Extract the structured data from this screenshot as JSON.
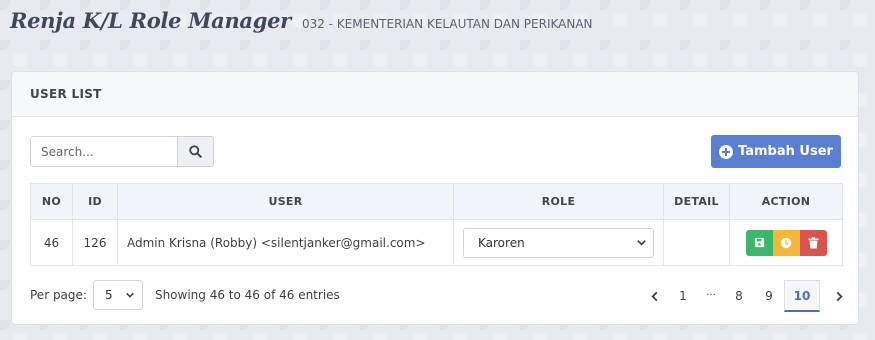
{
  "header": {
    "app_title": "Renja K/L Role Manager",
    "org_name": "032 - KEMENTERIAN KELAUTAN DAN PERIKANAN"
  },
  "card": {
    "title": "USER LIST"
  },
  "search": {
    "placeholder": "Search...",
    "value": "",
    "button_icon": "search-icon"
  },
  "add_user": {
    "label": "Tambah User",
    "icon": "plus-circle-icon",
    "color": "#5b7fd0"
  },
  "table": {
    "columns": [
      "NO",
      "ID",
      "USER",
      "ROLE",
      "DETAIL",
      "ACTION"
    ],
    "rows": [
      {
        "no": "46",
        "id": "126",
        "user": "Admin Krisna (Robby) <silentjanker@gmail.com>",
        "role": "Karoren",
        "detail": "",
        "actions": [
          {
            "icon": "save-icon",
            "color": "#3fb56a"
          },
          {
            "icon": "clock-icon",
            "color": "#f2b83b"
          },
          {
            "icon": "trash-icon",
            "color": "#d9534f"
          }
        ]
      }
    ]
  },
  "footer": {
    "per_page_label": "Per page:",
    "per_page_value": "5",
    "entries_text": "Showing 46 to 46 of 46 entries"
  },
  "pagination": {
    "pages": [
      "1",
      "8",
      "9",
      "10"
    ],
    "ellipsis": "...",
    "current": "10"
  }
}
